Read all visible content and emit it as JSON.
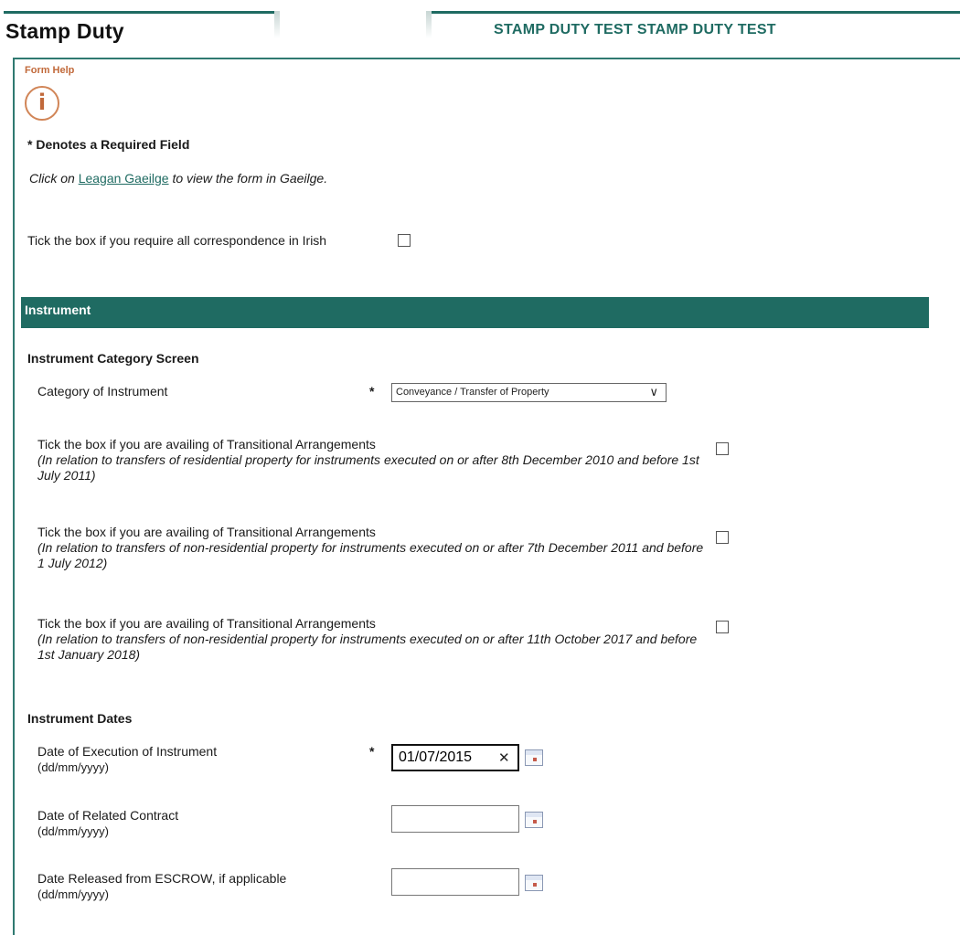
{
  "header": {
    "app_title": "Stamp Duty",
    "environment_banner": "STAMP DUTY TEST STAMP DUTY TEST"
  },
  "help": {
    "label": "Form Help",
    "icon_glyph": "i",
    "required_note": "* Denotes a Required Field",
    "gaeilge_prefix": "Click on ",
    "gaeilge_link": "Leagan Gaeilge",
    "gaeilge_suffix": " to view the form in Gaeilge."
  },
  "irish_correspondence": {
    "label": "Tick the box if you require all correspondence in Irish",
    "checked": false
  },
  "section": {
    "title": "Instrument"
  },
  "category_screen": {
    "heading": "Instrument Category Screen",
    "category_label": "Category of Instrument",
    "required_star": "*",
    "selected_value": "Conveyance / Transfer of Property"
  },
  "transitional": [
    {
      "label": "Tick the box if you are availing of Transitional Arrangements",
      "note": "(In relation to transfers of residential property for instruments executed on or after 8th December 2010 and before 1st July 2011)",
      "checked": false
    },
    {
      "label": "Tick the box if you are availing of Transitional Arrangements",
      "note": "(In relation to transfers of non-residential property for instruments executed on or after 7th December 2011 and before 1 July 2012)",
      "checked": false
    },
    {
      "label": "Tick the box if you are availing of Transitional Arrangements",
      "note": "(In relation to transfers of non-residential property for instruments executed on or after 11th October 2017 and before 1st January 2018)",
      "checked": false
    }
  ],
  "dates": {
    "heading": "Instrument Dates",
    "required_star": "*",
    "clear_glyph": "✕",
    "execution": {
      "label": "Date of Execution of Instrument",
      "format": "(dd/mm/yyyy)",
      "value": "01/07/2015"
    },
    "related_contract": {
      "label": "Date of Related Contract",
      "format": "(dd/mm/yyyy)",
      "value": ""
    },
    "escrow": {
      "label": "Date Released from ESCROW, if applicable",
      "format": "(dd/mm/yyyy)",
      "value": ""
    }
  },
  "colors": {
    "brand_teal": "#1f6b62",
    "help_orange": "#c1693a"
  }
}
